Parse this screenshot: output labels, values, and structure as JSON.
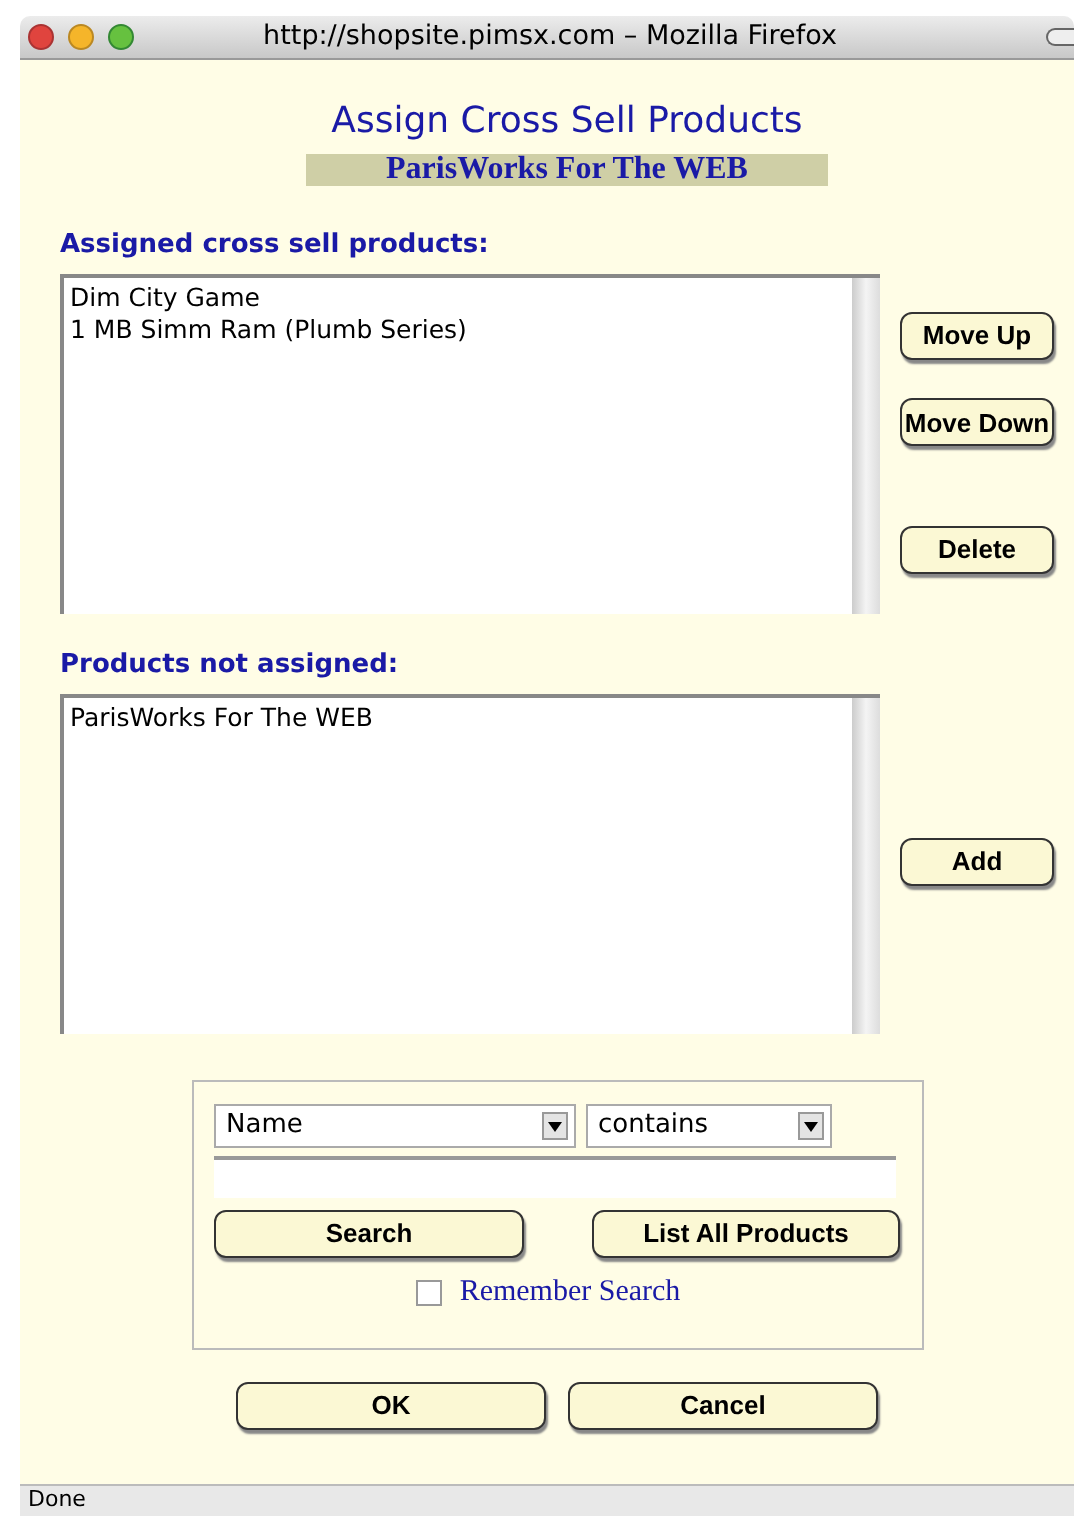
{
  "window": {
    "title": "http://shopsite.pimsx.com – Mozilla Firefox"
  },
  "page_title": "Assign Cross Sell Products",
  "product_banner": "ParisWorks For The WEB",
  "assigned": {
    "label": "Assigned cross sell products:",
    "items": [
      {
        "text": "Dim City Game"
      },
      {
        "text": "1 MB Simm Ram (Plumb Series)"
      }
    ],
    "buttons": [
      "Move Up",
      "Move Down",
      "Delete"
    ]
  },
  "not_assigned": {
    "label": "Products not assigned:",
    "items": [
      {
        "text": "ParisWorks For The WEB"
      }
    ],
    "buttons": [
      "Add"
    ]
  },
  "search": {
    "field_select": "Name",
    "operator_select": "contains",
    "buttons": [
      "Search",
      "List All Products"
    ],
    "remember": {
      "label": "Remember Search",
      "checked": false
    }
  },
  "buttons": [
    "OK",
    "Cancel"
  ],
  "status_bar": "Done"
}
